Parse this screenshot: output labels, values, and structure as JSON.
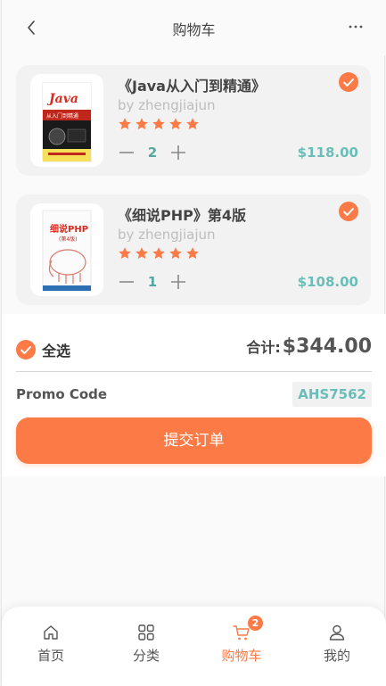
{
  "header": {
    "title": "购物车"
  },
  "items": [
    {
      "title": "《Java从入门到精通》",
      "author": "by zhengjiajun",
      "rating": 5,
      "quantity": "2",
      "price": "$118.00",
      "checked": true,
      "cover_text": [
        "Java",
        "从入门到精通"
      ]
    },
    {
      "title": "《细说PHP》第4版",
      "author": "by zhengjiajun",
      "rating": 5,
      "quantity": "1",
      "price": "$108.00",
      "checked": true,
      "cover_text": [
        "细说PHP",
        "(第4版)"
      ]
    }
  ],
  "summary": {
    "select_all_label": "全选",
    "total_label": "合计:",
    "total_value": "$344.00",
    "promo_label": "Promo Code",
    "promo_code": "AHS7562",
    "submit_label": "提交订单"
  },
  "nav": {
    "items": [
      {
        "label": "首页",
        "icon": "home-icon"
      },
      {
        "label": "分类",
        "icon": "grid-icon"
      },
      {
        "label": "购物车",
        "icon": "cart-icon",
        "active": true,
        "badge": "2"
      },
      {
        "label": "我的",
        "icon": "user-icon"
      }
    ]
  },
  "colors": {
    "accent": "#fb7a46",
    "price": "#6bbeb7",
    "qty": "#58a6a0"
  }
}
